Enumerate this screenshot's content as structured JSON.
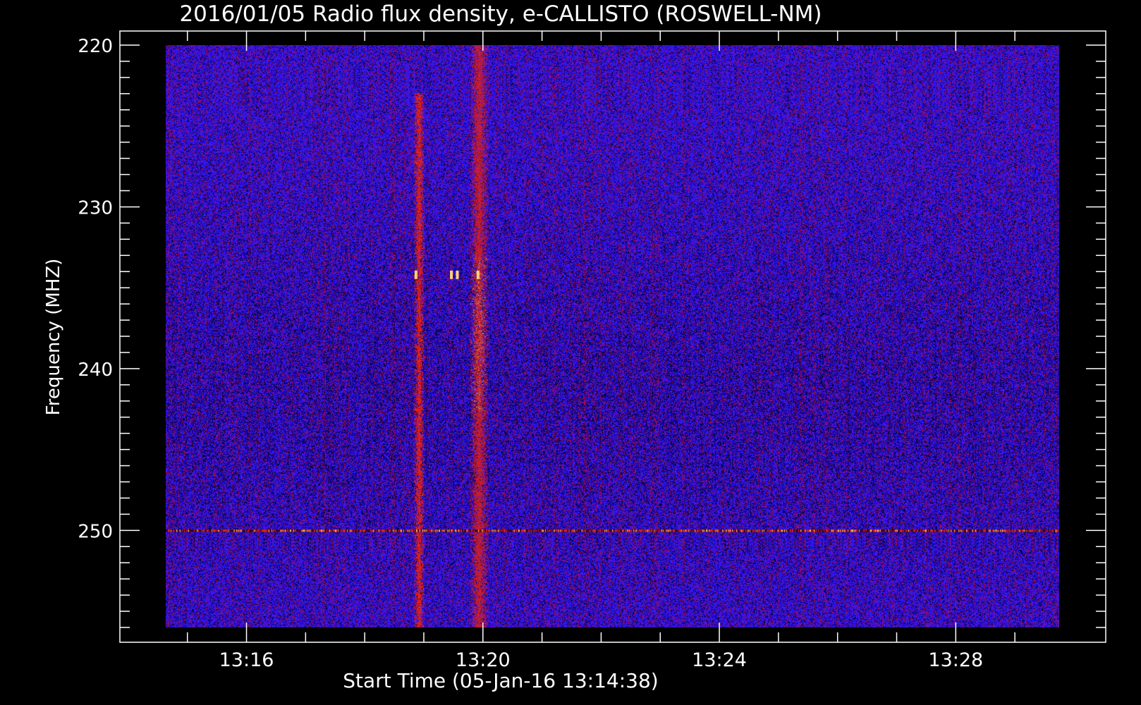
{
  "chart_data": {
    "type": "heatmap",
    "title": "2016/01/05  Radio flux density, e-CALLISTO (ROSWELL-NM)",
    "xlabel": "Start Time (05-Jan-16 13:14:38)",
    "ylabel": "Frequency (MHZ)",
    "x_unit": "time (UT, hh:mm)",
    "xlim": [
      "13:14:38",
      "13:29:45"
    ],
    "ylim": [
      220,
      256
    ],
    "y_inverted": true,
    "x_ticks": [
      "13:16",
      "13:20",
      "13:24",
      "13:28"
    ],
    "y_ticks": [
      220,
      230,
      240,
      250
    ],
    "colormap": [
      "#000000",
      "#1a00c8",
      "#2a10ff",
      "#b01010",
      "#ff2a00",
      "#ffd080"
    ],
    "background_color": "#000000",
    "features": [
      {
        "kind": "vertical_burst",
        "time": "13:18:55",
        "freq_range": [
          223,
          256
        ],
        "intensity": "medium"
      },
      {
        "kind": "vertical_burst",
        "time": "13:19:56",
        "freq_range": [
          220,
          256
        ],
        "intensity": "high"
      },
      {
        "kind": "horizontal_interference",
        "freq": 250,
        "time_range": [
          "13:14:38",
          "13:29:45"
        ],
        "intensity": "medium"
      },
      {
        "kind": "spot",
        "time": "13:18:52",
        "freq": 234.2
      },
      {
        "kind": "spot",
        "time": "13:19:28",
        "freq": 234.2
      },
      {
        "kind": "spot",
        "time": "13:19:34",
        "freq": 234.2
      },
      {
        "kind": "spot",
        "time": "13:19:55",
        "freq": 234.2
      }
    ]
  }
}
